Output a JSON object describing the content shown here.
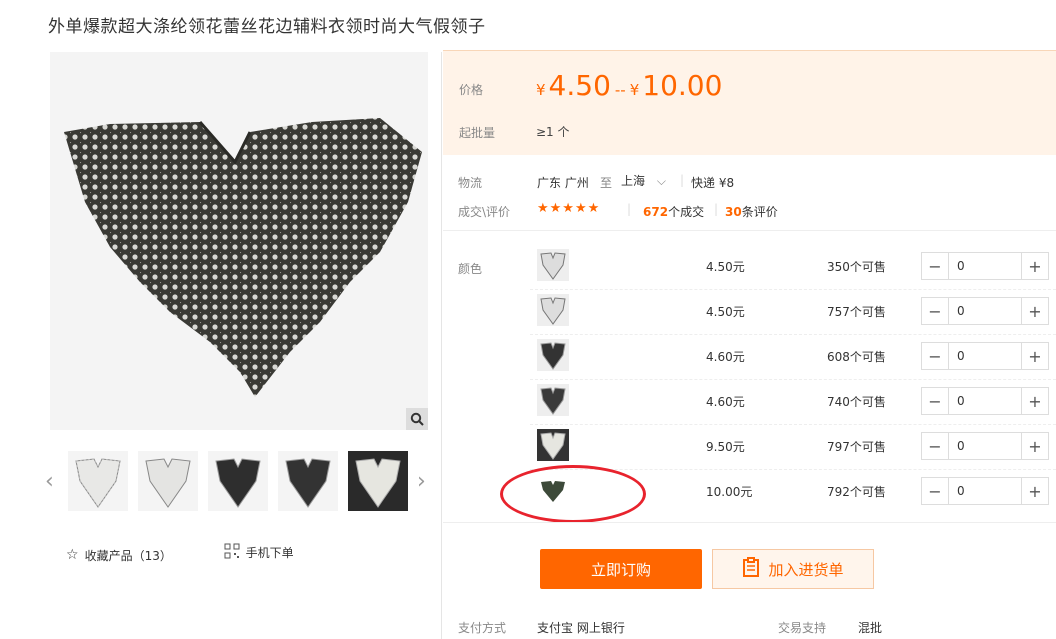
{
  "title": "外单爆款超大涤纶领花蕾丝花边辅料衣领时尚大气假领子",
  "gallery": {
    "zoom_icon": "search-icon",
    "thumbnails": [
      "white-lace-collar",
      "white-lace-collar",
      "black-lace-collar",
      "black-lace-collar",
      "white-lace-on-black"
    ]
  },
  "actions": {
    "favorite_label": "收藏产品（13）",
    "mobile_label": "手机下单"
  },
  "price": {
    "label": "价格",
    "currency": "¥",
    "low": "4.50",
    "dash": "--",
    "high": "10.00",
    "min_label": "起批量",
    "min_value": "≥1 个"
  },
  "logistics": {
    "label": "物流",
    "from": "广东 广州",
    "to_word": "至",
    "to": "上海",
    "express": "快递 ¥8"
  },
  "deals": {
    "label": "成交\\评价",
    "stars": "★★★★★",
    "count": "672",
    "count_suffix": "个成交",
    "reviews": "30",
    "reviews_suffix": "条评价"
  },
  "spec": {
    "label": "颜色",
    "rows": [
      {
        "price": "4.50元",
        "stock": "350个可售",
        "qty": "0",
        "swatch": "white"
      },
      {
        "price": "4.50元",
        "stock": "757个可售",
        "qty": "0",
        "swatch": "white"
      },
      {
        "price": "4.60元",
        "stock": "608个可售",
        "qty": "0",
        "swatch": "black"
      },
      {
        "price": "4.60元",
        "stock": "740个可售",
        "qty": "0",
        "swatch": "black"
      },
      {
        "price": "9.50元",
        "stock": "797个可售",
        "qty": "0",
        "swatch": "white-on-black"
      },
      {
        "price": "10.00元",
        "stock": "792个可售",
        "qty": "0",
        "swatch": "dark-green"
      }
    ]
  },
  "buttons": {
    "buy": "立即订购",
    "cart": "加入进货单"
  },
  "payment": {
    "label": "支付方式",
    "methods": "支付宝 网上银行",
    "support_label": "交易支持",
    "support_value": "混批"
  },
  "colors": {
    "accent": "#ff6600",
    "annotation": "#e8232d"
  }
}
